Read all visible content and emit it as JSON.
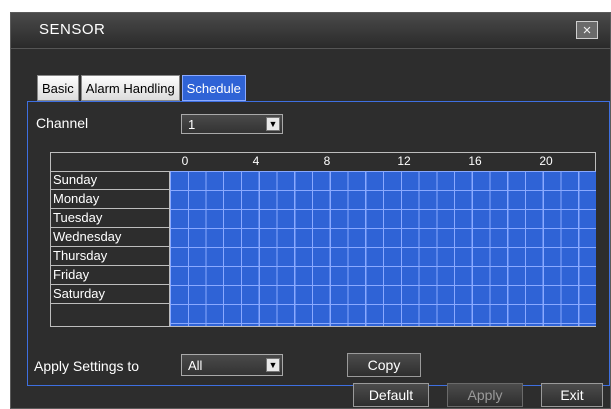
{
  "window": {
    "title": "SENSOR",
    "close_icon": "×"
  },
  "tabs": [
    {
      "label": "Basic",
      "active": false
    },
    {
      "label": "Alarm Handling",
      "active": false
    },
    {
      "label": "Schedule",
      "active": true
    }
  ],
  "channel": {
    "label": "Channel",
    "value": "1"
  },
  "schedule": {
    "hour_ticks": [
      "0",
      "4",
      "8",
      "12",
      "16",
      "20"
    ],
    "days": [
      "Sunday",
      "Monday",
      "Tuesday",
      "Wednesday",
      "Thursday",
      "Friday",
      "Saturday"
    ]
  },
  "apply_settings": {
    "label": "Apply Settings to",
    "value": "All",
    "copy_label": "Copy"
  },
  "footer": {
    "default_label": "Default",
    "apply_label": "Apply",
    "exit_label": "Exit"
  },
  "colors": {
    "cell_fill": "#2f63d6",
    "grid_line": "#8aa9ff",
    "panel_bg": "#2d2d2d"
  }
}
